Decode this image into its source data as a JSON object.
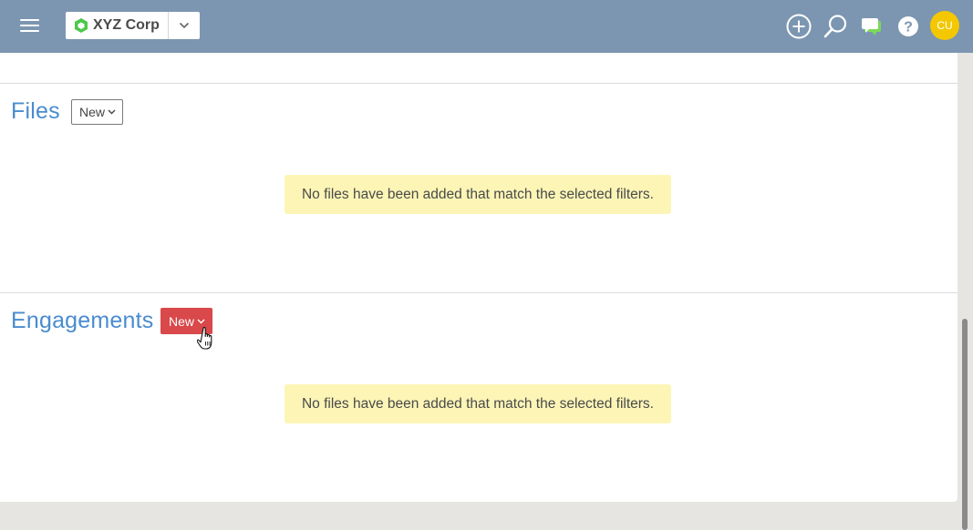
{
  "header": {
    "org_name": "XYZ Corp",
    "avatar_initials": "CU",
    "colors": {
      "bar": "#7c96b1",
      "avatar": "#f3c800",
      "logo": "#4cc84a"
    },
    "icons": [
      "menu-icon",
      "add-circle-icon",
      "search-icon",
      "chat-icon",
      "help-icon"
    ]
  },
  "files": {
    "title": "Files",
    "new_label": "New",
    "empty_message": "No files have been added that match the selected filters."
  },
  "engagements": {
    "title": "Engagements",
    "new_label": "New",
    "empty_message": "No files have been added that match the selected filters."
  },
  "colors": {
    "section_title": "#4a8ccf",
    "primary_button": "#d9484a",
    "notice_bg": "#fcf5b6"
  }
}
